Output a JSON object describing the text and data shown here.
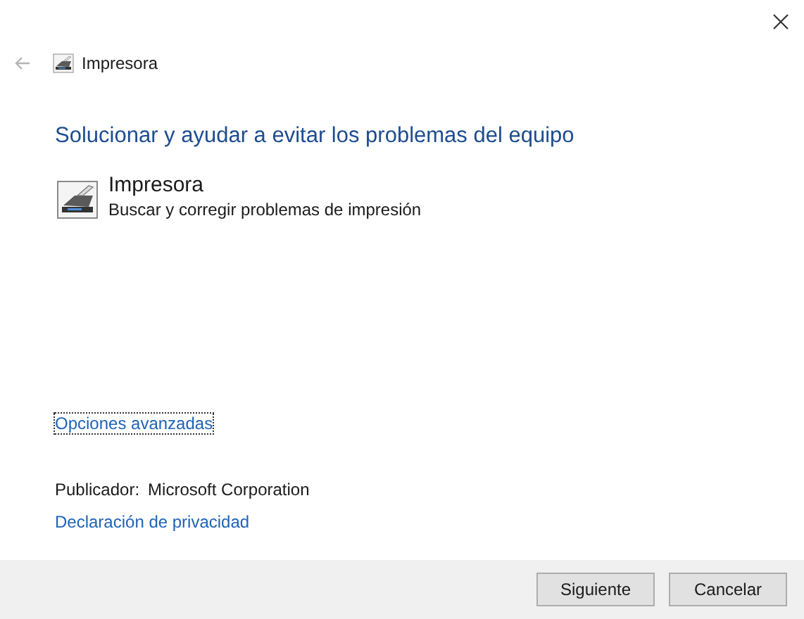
{
  "window": {
    "title": "Impresora"
  },
  "heading": "Solucionar y ayudar a evitar los problemas del equipo",
  "troubleshooter": {
    "name": "Impresora",
    "description": "Buscar y corregir problemas de impresión"
  },
  "advanced_link": "Opciones avanzadas",
  "publisher": {
    "label": "Publicador:",
    "value": "Microsoft Corporation"
  },
  "privacy_link": "Declaración de privacidad",
  "buttons": [
    "Siguiente",
    "Cancelar"
  ]
}
